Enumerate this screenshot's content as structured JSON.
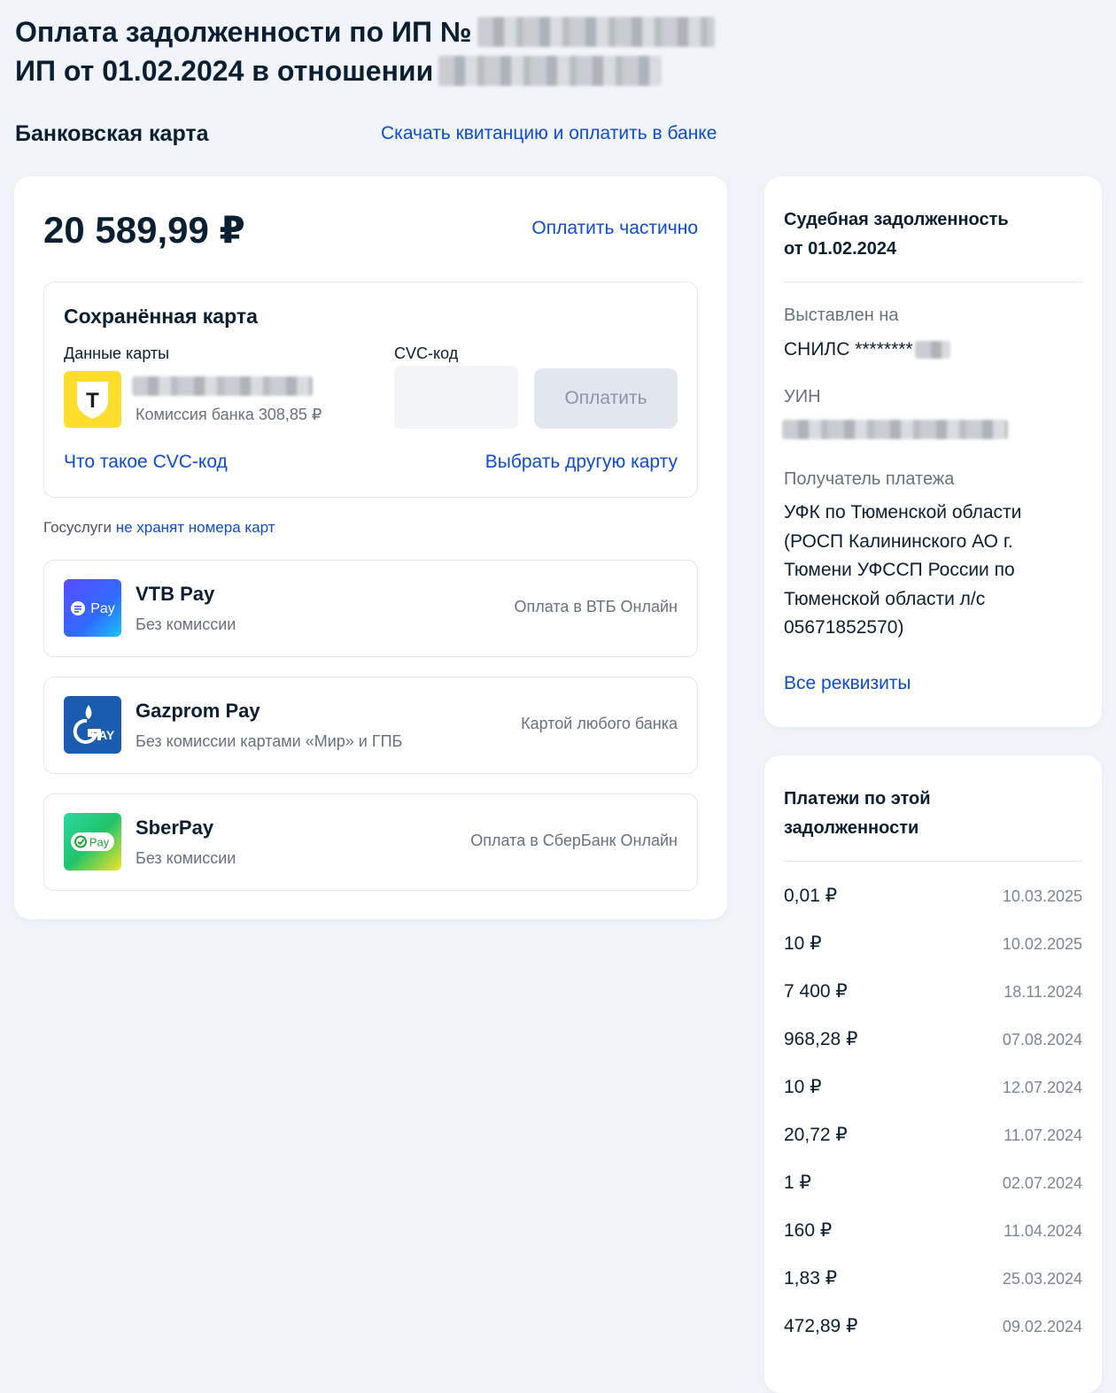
{
  "header": {
    "title_line1": "Оплата задолженности по ИП №",
    "title_line2": "ИП от 01.02.2024 в отношении"
  },
  "tabs": {
    "bank_card": "Банковская карта",
    "receipt_link": "Скачать квитанцию и оплатить в банке"
  },
  "payment": {
    "amount": "20 589,99 ₽",
    "partial_link": "Оплатить частично",
    "saved_card": {
      "title": "Сохранённая карта",
      "card_data_label": "Данные карты",
      "logo_letter": "Т",
      "commission": "Комиссия банка 308,85 ₽",
      "cvc_label": "CVC-код",
      "pay_button": "Оплатить",
      "cvc_help_link": "Что такое CVC-код",
      "choose_other_link": "Выбрать другую карту"
    },
    "gos_note_prefix": "Госуслуги",
    "gos_note_link": "не хранят номера карт",
    "options": [
      {
        "name": "VTB Pay",
        "sub": "Без комиссии",
        "right": "Оплата в ВТБ Онлайн",
        "logo_text": "Pay"
      },
      {
        "name": "Gazprom Pay",
        "sub": "Без комиссии картами «Мир» и ГПБ",
        "right": "Картой любого банка",
        "logo_text": "PAY"
      },
      {
        "name": "SberPay",
        "sub": "Без комиссии",
        "right": "Оплата в СберБанк Онлайн",
        "logo_text": "Pay"
      }
    ]
  },
  "debt_info": {
    "title_line1": "Судебная задолженность",
    "title_line2": "от 01.02.2024",
    "issued_label": "Выставлен на",
    "issued_value": "СНИЛС ********",
    "uin_label": "УИН",
    "recipient_label": "Получатель платежа",
    "recipient_lines": [
      "УФК по Тюменской области",
      "(РОСП Калининского АО г.",
      "Тюмени УФССП России по",
      "Тюменской области л/с",
      "05671852570)"
    ],
    "all_details_link": "Все реквизиты"
  },
  "payments_history": {
    "title_line1": "Платежи по этой",
    "title_line2": "задолженности",
    "items": [
      {
        "amount": "0,01 ₽",
        "date": "10.03.2025"
      },
      {
        "amount": "10 ₽",
        "date": "10.02.2025"
      },
      {
        "amount": "7 400 ₽",
        "date": "18.11.2024"
      },
      {
        "amount": "968,28 ₽",
        "date": "07.08.2024"
      },
      {
        "amount": "10 ₽",
        "date": "12.07.2024"
      },
      {
        "amount": "20,72 ₽",
        "date": "11.07.2024"
      },
      {
        "amount": "1 ₽",
        "date": "02.07.2024"
      },
      {
        "amount": "160 ₽",
        "date": "11.04.2024"
      },
      {
        "amount": "1,83 ₽",
        "date": "25.03.2024"
      },
      {
        "amount": "472,89 ₽",
        "date": "09.02.2024"
      }
    ]
  },
  "colors": {
    "link": "#0d4cd3",
    "background": "#f1f5fb",
    "tbank_yellow": "#ffdd2d",
    "gazprom_blue": "#1a5cb0"
  }
}
